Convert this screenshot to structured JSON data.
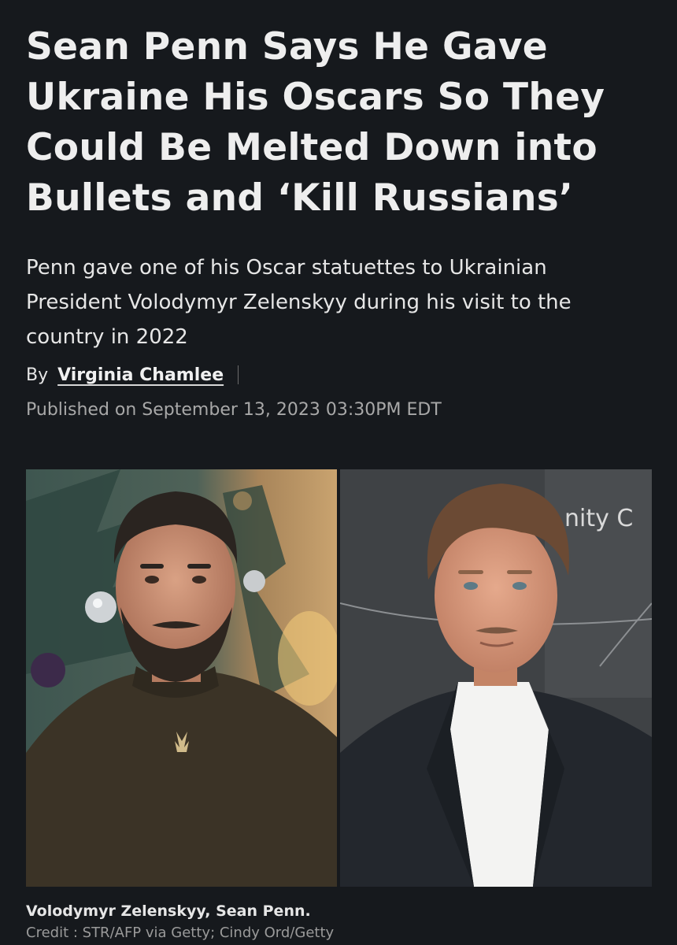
{
  "article": {
    "headline": "Sean Penn Says He Gave Ukraine His Oscars So They Could Be Melted Down into Bullets and ‘Kill Russians’",
    "dek": "Penn gave one of his Oscar statuettes to Ukrainian President Volodymyr Zelenskyy during his visit to the country in 2022",
    "byline_prefix": "By",
    "author": "Virginia Chamlee",
    "published": "Published on September 13, 2023 03:30PM EDT"
  },
  "image": {
    "left_photo_subject": "Volodymyr Zelenskyy",
    "right_photo_subject": "Sean Penn",
    "backdrop_text": "nity C",
    "caption": "Volodymyr Zelenskyy, Sean Penn.",
    "credit": "Credit : STR/AFP via Getty; Cindy Ord/Getty"
  },
  "colors": {
    "background": "#16191d",
    "headline": "#eeeeee",
    "meta": "#a8a8a8"
  }
}
